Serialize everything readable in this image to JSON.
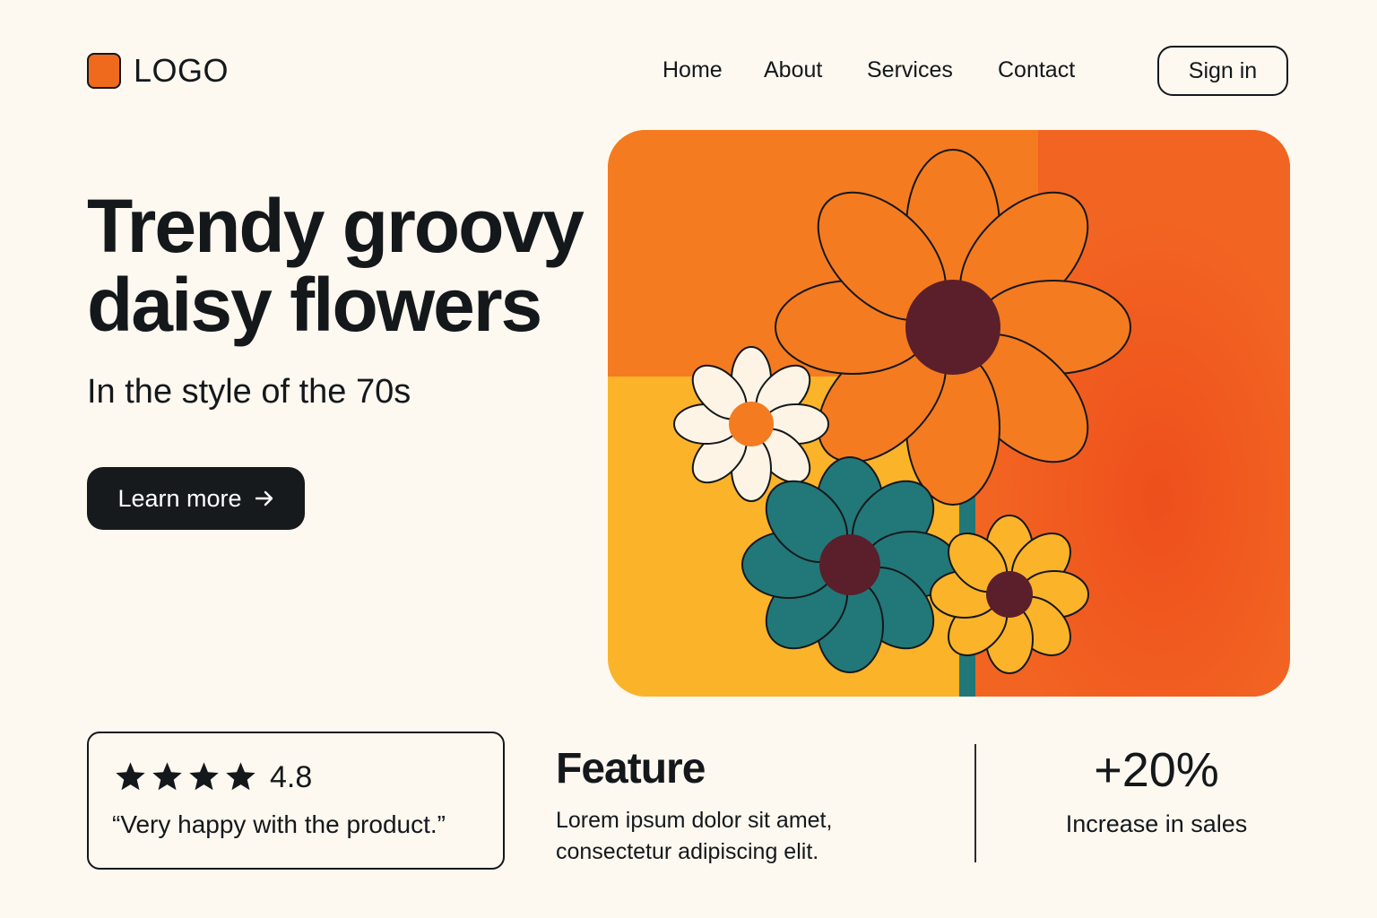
{
  "header": {
    "logo_text": "LOGO",
    "nav": [
      "Home",
      "About",
      "Services",
      "Contact"
    ],
    "signin_label": "Sign in"
  },
  "hero": {
    "title_line1": "Trendy groovy",
    "title_line2": "daisy flowers",
    "subtitle": "In the style of the 70s",
    "cta_label": "Learn more",
    "cta_icon": "arrow-right-icon"
  },
  "review": {
    "stars": 4,
    "star_icon": "star-icon",
    "rating": "4.8",
    "quote": "“Very happy with the product.”"
  },
  "feature": {
    "title": "Feature",
    "text_line1": "Lorem ipsum dolor sit amet,",
    "text_line2": "consectetur adipiscing elit."
  },
  "stat": {
    "value": "+20%",
    "label": "Increase in sales"
  },
  "colors": {
    "background": "#fdf8f0",
    "accent_orange": "#ef6a1c",
    "dark": "#14181b",
    "yellow": "#fbb32a",
    "teal": "#227779",
    "maroon": "#5a1f2a",
    "cream_petal": "#fdf4e6"
  }
}
